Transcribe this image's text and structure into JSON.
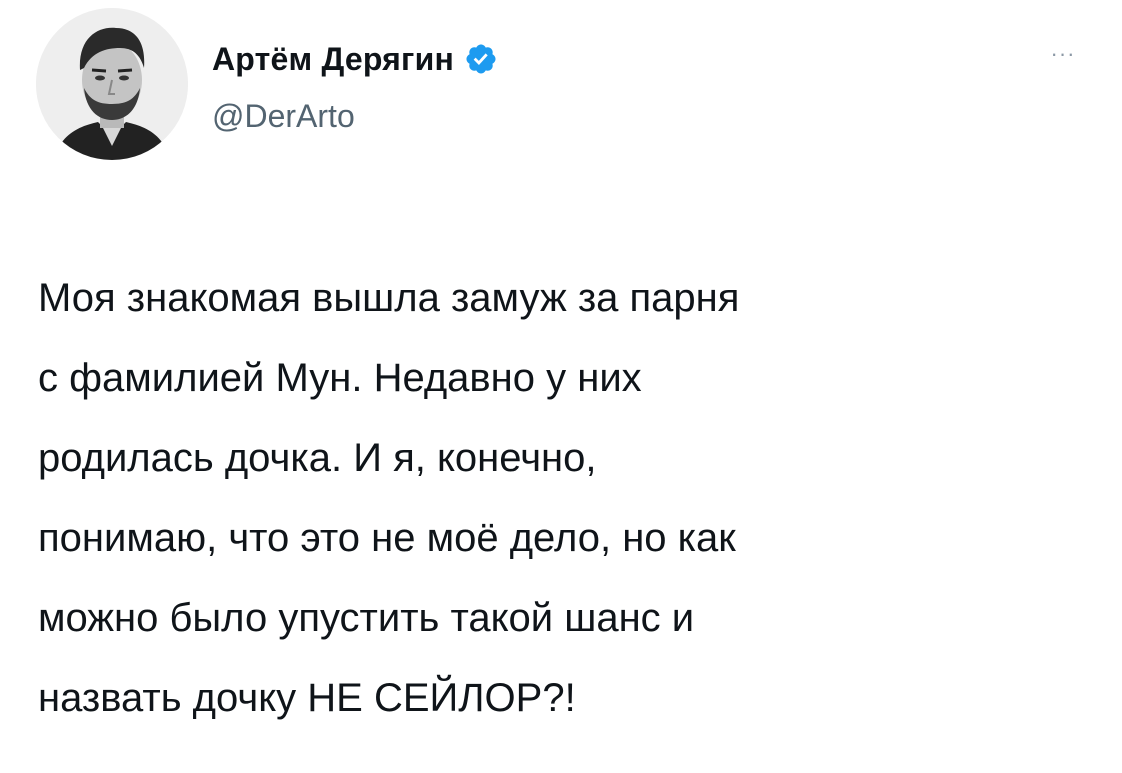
{
  "author": {
    "display_name": "Артём Дерягин",
    "handle": "@DerArto",
    "verified": true,
    "avatar_icon": "avatar-photo-icon",
    "verified_icon": "verified-badge-icon",
    "verified_color": "#1d9bf0"
  },
  "menu": {
    "more_label": "···",
    "more_icon": "more-options-icon"
  },
  "tweet": {
    "lines": [
      "Моя знакомая вышла замуж за парня",
      "с фамилией Мун. Недавно у них",
      "родилась дочка. И я, конечно,",
      "понимаю, что это не моё дело, но как",
      "можно было упустить такой шанс и",
      "назвать дочку НЕ СЕЙЛОР?!"
    ]
  },
  "colors": {
    "text": "#0f1419",
    "secondary": "#536471",
    "background": "#ffffff"
  }
}
